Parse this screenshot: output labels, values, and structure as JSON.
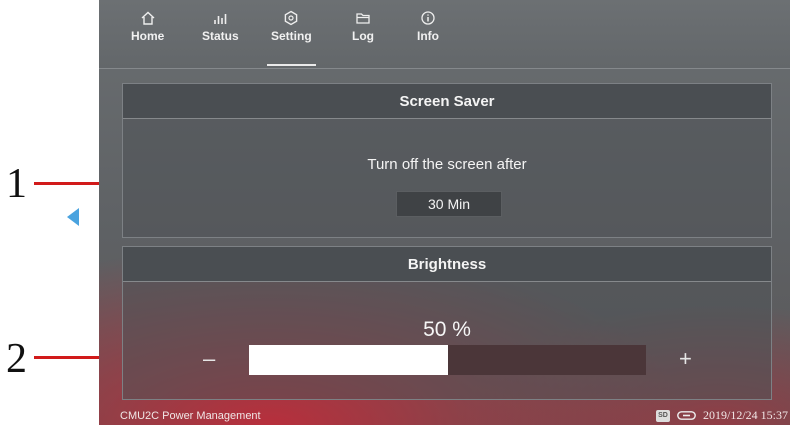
{
  "nav": {
    "tabs": [
      {
        "label": "Home",
        "icon": "home-icon"
      },
      {
        "label": "Status",
        "icon": "status-bars-icon"
      },
      {
        "label": "Setting",
        "icon": "gear-icon",
        "active": true
      },
      {
        "label": "Log",
        "icon": "folder-icon"
      },
      {
        "label": "Info",
        "icon": "info-icon"
      }
    ]
  },
  "screen_saver": {
    "title": "Screen Saver",
    "prompt": "Turn off the screen after",
    "value": "30 Min"
  },
  "brightness": {
    "title": "Brightness",
    "percent_label": "50 %",
    "level": 0.5,
    "decrease_label": "–",
    "increase_label": "+"
  },
  "status_bar": {
    "app_name": "CMU2C Power Management",
    "sd_label": "SD",
    "datetime": "2019/12/24 15:37"
  },
  "callouts": [
    "1",
    "2"
  ],
  "colors": {
    "callout_line": "#d11a1a",
    "accent_bottom_glow": "#c82837",
    "bar_fill": "#ffffff",
    "bar_track": "#4b3639"
  }
}
